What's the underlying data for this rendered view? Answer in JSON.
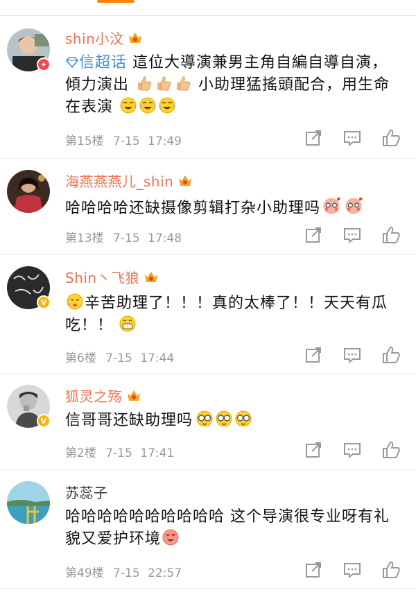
{
  "comments": [
    {
      "username": "shin小汶",
      "topic_label": "信超话",
      "text": "這位大導演兼男主角自編自導自演，傾力演出",
      "text_after_thumbs": "小助理猛搖頭配合，用生命在表演",
      "floor": "第15楼",
      "date": "7-15",
      "time": "17:49",
      "badge_color": "#f24b48"
    },
    {
      "username": "海燕燕燕儿_shin",
      "text": "哈哈哈哈还缺摄像剪辑打杂小助理吗",
      "floor": "第13楼",
      "date": "7-15",
      "time": "17:48"
    },
    {
      "username": "Shin丶飞狼",
      "text": "辛苦助理了！！！真的太棒了！！天天有瓜吃！！",
      "floor": "第6楼",
      "date": "7-15",
      "time": "17:44",
      "badge_color": "#f7b500"
    },
    {
      "username": "狐灵之殇",
      "text": "信哥哥还缺助理吗",
      "floor": "第2楼",
      "date": "7-15",
      "time": "17:41",
      "badge_color": "#f7b500"
    },
    {
      "username": "苏蕊子",
      "text": "哈哈哈哈哈哈哈哈哈哈 这个导演很专业呀有礼貌又爱护环境",
      "floor": "第49楼",
      "date": "7-15",
      "time": "22:57"
    }
  ],
  "colors": {
    "accent": "#ff8200",
    "username": "#eb7350",
    "topic": "#4a8fd8",
    "meta": "#999999"
  },
  "icons": [
    "share-icon",
    "comment-icon",
    "like-icon",
    "vip-crown-icon",
    "diamond-icon"
  ]
}
